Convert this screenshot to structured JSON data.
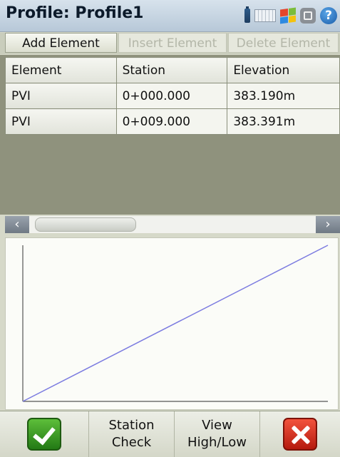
{
  "title": "Profile: Profile1",
  "tray_icons": [
    "battery-icon",
    "keyboard-icon",
    "windows-start-icon",
    "apps-icon",
    "help-icon"
  ],
  "help_glyph": "?",
  "toolbar": {
    "add": "Add Element",
    "insert": "Insert Element",
    "delete": "Delete Element"
  },
  "table": {
    "headers": [
      "Element",
      "Station",
      "Elevation"
    ],
    "rows": [
      [
        "PVI",
        "0+000.000",
        "383.190m"
      ],
      [
        "PVI",
        "0+009.000",
        "383.391m"
      ]
    ]
  },
  "scroll": {
    "left_glyph": "‹",
    "right_glyph": "›"
  },
  "profile_plot": {
    "points": [
      {
        "station": 0.0,
        "elevation": 383.19
      },
      {
        "station": 9.0,
        "elevation": 383.391
      }
    ],
    "line_color": "#7b7be0",
    "axis_color": "#555555"
  },
  "bottom": {
    "station_check_1": "Station",
    "station_check_2": "Check",
    "view_1": "View",
    "view_2": "High/Low"
  },
  "colors": {
    "accept": "#3a9a25",
    "cancel": "#d8301c"
  }
}
